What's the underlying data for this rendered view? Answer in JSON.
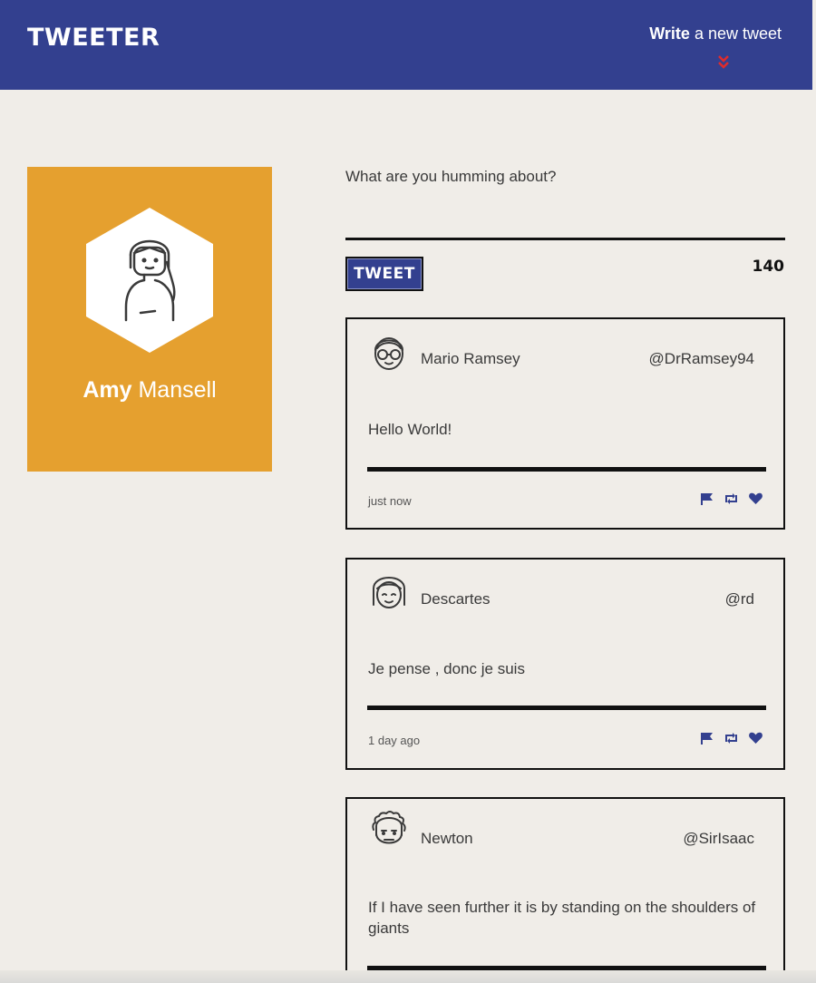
{
  "header": {
    "logo": "TWEETER",
    "write_strong": "Write",
    "write_rest": " a new tweet",
    "chevron_icon": "double-chevron-down-icon",
    "chevron_color": "#e02b2b",
    "bar_color": "#33408f"
  },
  "profile": {
    "first_name": "Amy",
    "last_name": "Mansell",
    "avatar_icon": "woman-avatar-icon",
    "card_color": "#e5a02f"
  },
  "composer": {
    "prompt": "What are you humming about?",
    "button_label": "TWEET",
    "char_count": "140"
  },
  "tweets": [
    {
      "author": "Mario Ramsey",
      "handle": "@DrRamsey94",
      "content": "Hello World!",
      "time": "just now",
      "avatar_icon": "man-glasses-avatar-icon"
    },
    {
      "author": "Descartes",
      "handle": "@rd",
      "content": "Je pense , donc je suis",
      "time": "1 day ago",
      "avatar_icon": "bob-hair-avatar-icon"
    },
    {
      "author": "Newton",
      "handle": "@SirIsaac",
      "content": "If I have seen further it is by standing on the shoulders of giants",
      "time": "",
      "avatar_icon": "curly-hair-avatar-icon"
    }
  ],
  "actions": [
    "flag-icon",
    "retweet-icon",
    "heart-icon"
  ],
  "accent_color": "#33408f"
}
